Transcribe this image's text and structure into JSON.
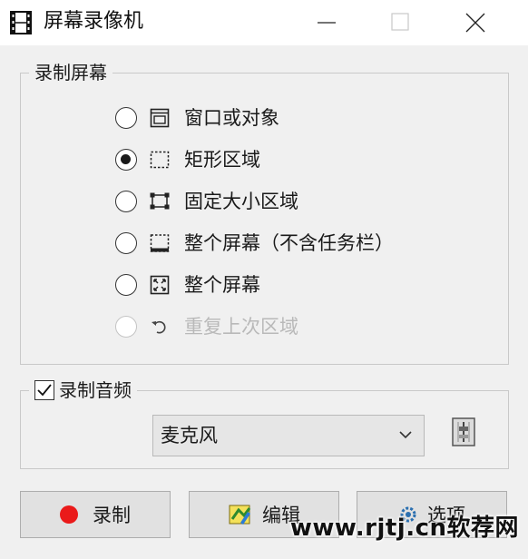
{
  "window": {
    "title": "屏幕录像机",
    "title_icon": "film-icon"
  },
  "title_buttons": [
    "minimize-icon",
    "maximize-icon",
    "close-icon"
  ],
  "record_group": {
    "legend": "录制屏幕",
    "options": [
      {
        "label": "窗口或对象",
        "icon": "window-icon",
        "selected": false,
        "enabled": true
      },
      {
        "label": "矩形区域",
        "icon": "dashed-rect-icon",
        "selected": true,
        "enabled": true
      },
      {
        "label": "固定大小区域",
        "icon": "fixed-size-icon",
        "selected": false,
        "enabled": true
      },
      {
        "label": "整个屏幕（不含任务栏）",
        "icon": "screen-no-taskbar-icon",
        "selected": false,
        "enabled": true
      },
      {
        "label": "整个屏幕",
        "icon": "fullscreen-icon",
        "selected": false,
        "enabled": true
      },
      {
        "label": "重复上次区域",
        "icon": "repeat-icon",
        "selected": false,
        "enabled": false
      }
    ]
  },
  "audio_group": {
    "legend": "录制音频",
    "checked": true,
    "device": "麦克风",
    "mixer_icon": "audio-mixer-icon"
  },
  "buttons": {
    "record": "录制",
    "edit": "编辑",
    "options": "选项"
  },
  "watermark": "www.rjtj.cn软荐网",
  "colors": {
    "record_dot": "#ea1a1a",
    "background": "#f0f0f0"
  }
}
